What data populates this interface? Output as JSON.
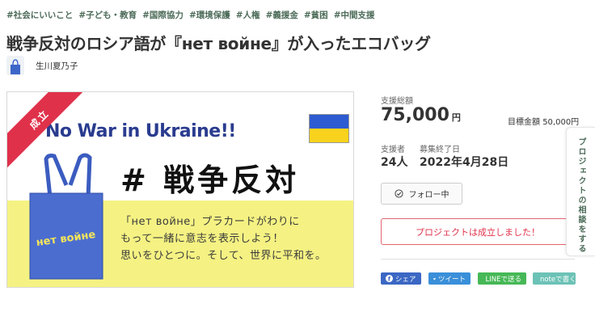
{
  "tags": [
    "#社会にいいこと",
    "#子ども・教育",
    "#国際協力",
    "#環境保護",
    "#人権",
    "#義援金",
    "#貧困",
    "#中間支援"
  ],
  "title": "戦争反対のロシア語が『нет войне』が入ったエコバッグ",
  "author": {
    "name": "生川夏乃子"
  },
  "hero": {
    "ribbon": "成立",
    "headline": "No War in Ukraine!!",
    "big_text": "# 戦争反対",
    "bag_text": "нет войне",
    "message_lines": [
      "「нет войне」プラカードがわりに",
      "もって一緒に意志を表示しよう！",
      "思いをひとつに。そして、世界に平和を。"
    ]
  },
  "stats": {
    "total_label": "支援総額",
    "total_value": "75,000",
    "total_unit": "円",
    "goal_label": "目標金額",
    "goal_value": "50,000円",
    "supporters_label": "支援者",
    "supporters_value": "24人",
    "end_label": "募集終了日",
    "end_value": "2022年4月28日"
  },
  "follow_label": "フォロー中",
  "success_message": "プロジェクトは成立しました！",
  "share": {
    "facebook": "シェア",
    "twitter": "ツイート",
    "line": "LINEで送る",
    "note": "noteで書く"
  },
  "side_tab": "プロジェクトの相談をする",
  "colors": {
    "accent_green": "#4c6b58",
    "success_red": "#e0314b",
    "facebook": "#3b67c4",
    "twitter": "#3a8fd9",
    "line": "#46b856",
    "note": "#6cc2b6"
  }
}
